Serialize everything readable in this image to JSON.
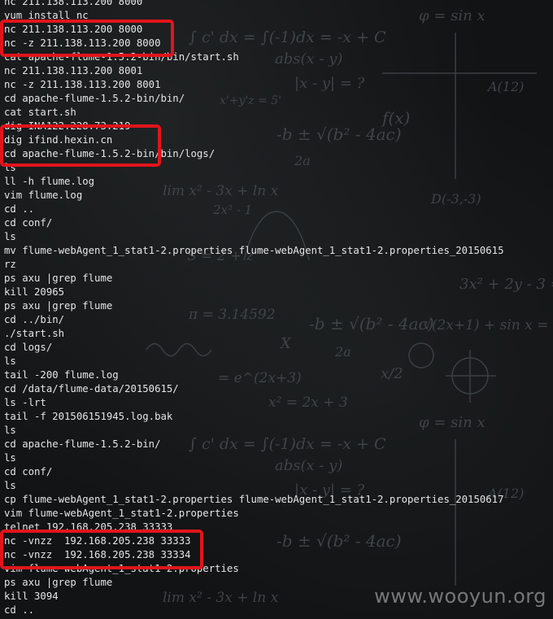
{
  "terminal": {
    "lines": [
      "nc 211.138.113.200 8000",
      "yum install nc",
      "nc 211.138.113.200 8000",
      "nc -z 211.138.113.200 8000",
      "cat apache-flume-1.5.2-bin/bin/start.sh",
      "nc 211.138.113.200 8001",
      "nc -z 211.138.113.200 8001",
      "cd apache-flume-1.5.2-bin/bin/",
      "cat start.sh",
      "dig INA122.228.73.219",
      "dig ifind.hexin.cn",
      "cd apache-flume-1.5.2-bin/bin/logs/",
      "ls",
      "ll -h flume.log",
      "vim flume.log",
      "cd ..",
      "cd conf/",
      "ls",
      "mv flume-webAgent_1_stat1-2.properties flume-webAgent_1_stat1-2.properties_20150615",
      "rz",
      "ps axu |grep flume",
      "kill 20965",
      "ps axu |grep flume",
      "cd ../bin/",
      "./start.sh",
      "cd logs/",
      "ls",
      "tail -200 flume.log",
      "cd /data/flume-data/20150615/",
      "ls -lrt",
      "tail -f 201506151945.log.bak",
      "ls",
      "cd apache-flume-1.5.2-bin/",
      "ls",
      "cd conf/",
      "ls",
      "cp flume-webAgent_1_stat1-2.properties flume-webAgent_1_stat1-2.properties_20150617",
      "vim flume-webAgent_1_stat1-2.properties",
      "telnet 192.168.205.238 33333",
      "nc -vnzz  192.168.205.238 33333",
      "nc -vnzz  192.168.205.238 33334",
      "vim flume-webAgent_1_stat1-2.properties",
      "ps axu |grep flume",
      "kill 3094",
      "cd .."
    ]
  },
  "highlight_color": "#e2141b",
  "watermark": "www.wooyun.org"
}
